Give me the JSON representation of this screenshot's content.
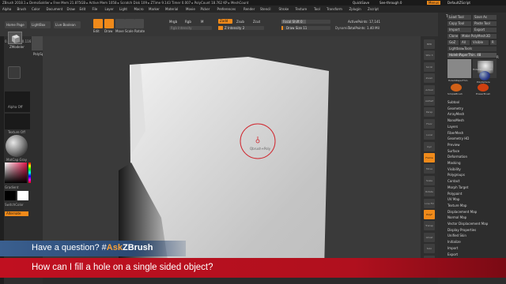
{
  "titlebar": {
    "left": "ZBrush 2018.1 ▸ DemoSoldier ▸ Free Mem 21.875GB ▸ Active Mem 1058 ▸ Scratch Disk 109 ▸ ZTime 9.143 Timer 0.007 ▸ PolyCount 18.762 KP ▸ MeshCount",
    "quicksave": "QuickSave",
    "seethrough": "See-through 0",
    "menus_btn": "Menus",
    "script": "DefaultZScript"
  },
  "menubar": [
    "Alpha",
    "Brush",
    "Color",
    "Document",
    "Draw",
    "Edit",
    "File",
    "Layer",
    "Light",
    "Macro",
    "Marker",
    "Material",
    "Movie",
    "Picker",
    "Preferences",
    "Render",
    "Stencil",
    "Stroke",
    "Texture",
    "Tool",
    "Transform",
    "Zplugin",
    "Zscript"
  ],
  "toolbar": {
    "home": "Home Page",
    "lightbox": "LightBox",
    "live_boolean": "Live Boolean",
    "edit": "Edit",
    "draw": "Draw",
    "move": "Move",
    "scale": "Scale",
    "rotate": "Rotate",
    "mrgb": "Mrgb",
    "rgb": "Rgb",
    "m": "M",
    "rgb_intensity": "Rgb Intensity",
    "zadd": "Zadd",
    "zsub": "Zsub",
    "zcut": "Zcut",
    "z_intensity": "Z Intensity 2",
    "focal_shift": "Focal Shift 0",
    "draw_size": "Draw Size 11",
    "dynamic": "Dynamic",
    "active_points": "ActivePoints: 17,141",
    "total_points": "TotalPoints: 1.40 Mil"
  },
  "lefttop": {
    "coords": "0.116,-0.2,0.116",
    "tool1": "ZModeler",
    "tool2": "PolySphere"
  },
  "leftshelf": {
    "alpha": "Alpha Off",
    "texture": "Texture Off",
    "matcap": "MatCap Gray",
    "gradient": "Gradient",
    "switchcolor": "SwitchColor",
    "alternate": "Alternate"
  },
  "canvas": {
    "cursor_label": "Qbrush+Poly"
  },
  "rightshelf": [
    "BPR",
    "SPix 3",
    "Scroll",
    "Zoom",
    "Actual",
    "AAHalf",
    "Persp",
    "Floor",
    "Local",
    "Gyz",
    "Frame",
    "Move",
    "Scale",
    "Rotate",
    "Line Fill",
    "PolyF",
    "Transp",
    "Ghost",
    "Solo",
    "Xpose"
  ],
  "toolpanel": {
    "title": "Tool",
    "load_tool": "Load Tool",
    "save_as": "Save As",
    "copy_tool": "Copy Tool",
    "paste_tool": "Paste Tool",
    "import": "Import",
    "export": "Export",
    "clone": "Clone",
    "make_polymesh": "Make PolyMesh3D",
    "goz": "GoZ",
    "all": "All",
    "visible": "Visible",
    "r": "R",
    "lightbox_tools": "Lightbox▸Tools",
    "current_tool": "HoleInPaperThin. 48",
    "thumbs": [
      "HoleInPaperThin",
      "HoleInPaperThin",
      "PolySphere",
      "SimpleBrush",
      "EraserBrush"
    ],
    "r_label": "R",
    "subpalettes": [
      "Subtool",
      "Geometry",
      "ArrayMesh",
      "NanoMesh",
      "Layers",
      "FiberMesh",
      "Geometry HD",
      "Preview",
      "Surface",
      "Deformation",
      "Masking",
      "Visibility",
      "Polygroups",
      "Contact",
      "Morph Target",
      "Polypaint",
      "UV Map",
      "Texture Map",
      "Displacement Map",
      "Normal Map",
      "Vector Displacement Map",
      "Display Properties",
      "Unified Skin",
      "Initialize",
      "Import",
      "Export"
    ]
  },
  "banners": {
    "question_prefix": "Have a question? #",
    "question_ask": "Ask",
    "question_brand": "ZBrush",
    "headline": "How can I fill a hole on a single sided object?"
  },
  "colors": {
    "accent": "#f08a1a",
    "banner_blue": "#2c4a74",
    "banner_red": "#c01020",
    "ask_color": "#f7a13a"
  }
}
